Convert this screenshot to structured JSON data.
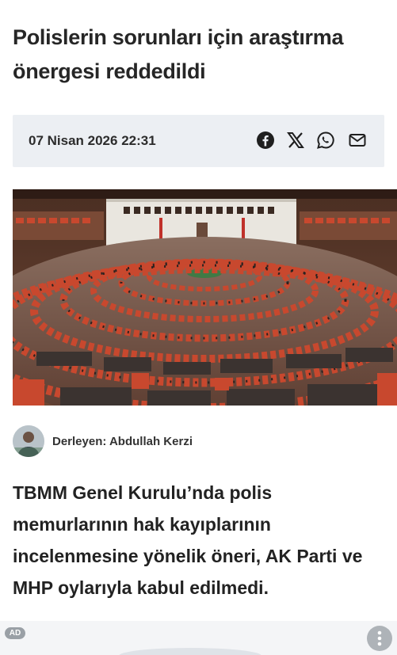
{
  "article": {
    "title": "Polislerin sorunları için araştırma önergesi reddedildi",
    "date": "07 Nisan 2026 22:31",
    "share_icons": [
      "facebook-icon",
      "x-icon",
      "whatsapp-icon",
      "mail-icon"
    ],
    "photo": "parliament-general-assembly-photo",
    "author_label": "Derleyen: Abdullah Kerzi",
    "lead": "TBMM Genel Kurulu’nda polis memurlarının hak kayıplarının incelenmesine yönelik öneri, AK Parti ve MHP oylarıyla kabul edilmedi."
  },
  "ad": {
    "badge": "AD",
    "more_icon": "more-vertical-icon"
  },
  "colors": {
    "meta_background": "#eceff3",
    "text": "#262626",
    "seat_red": "#c8482e"
  }
}
